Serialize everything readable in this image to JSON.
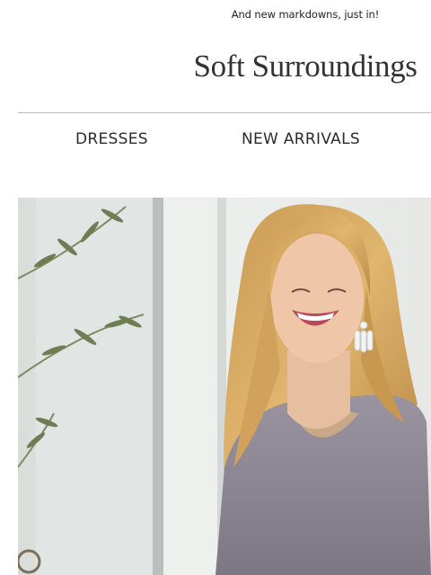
{
  "preheader": {
    "text": "And new markdowns, just in!"
  },
  "brand": {
    "logo_text": "Soft Surroundings"
  },
  "nav": {
    "items": [
      {
        "label": "DRESSES"
      },
      {
        "label": "NEW ARRIVALS"
      }
    ]
  },
  "colors": {
    "text": "#2b2b2b",
    "divider": "#bdbdbd",
    "hero_background": "#e9ebe8",
    "top_color": "#8d8794",
    "hair_color": "#d7a85e"
  }
}
